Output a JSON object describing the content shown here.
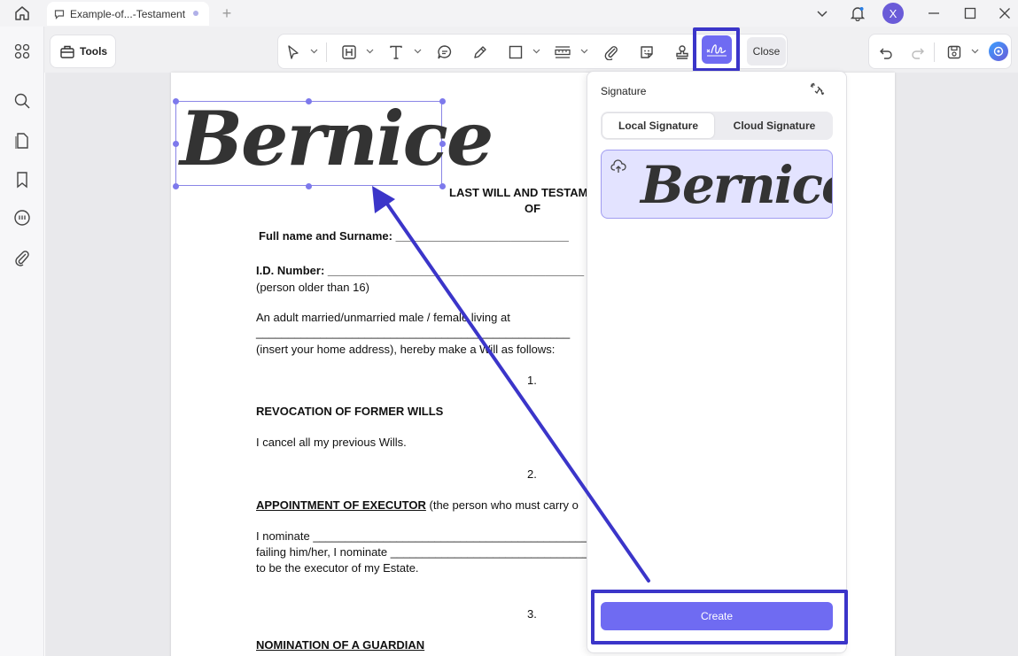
{
  "titlebar": {
    "tab_title": "Example-of...-Testament",
    "new_tab": "+",
    "avatar_letter": "X"
  },
  "toolbar": {
    "tools_label": "Tools",
    "close_label": "Close"
  },
  "document": {
    "signature_text": "Bernice",
    "heading_line1": "LAST WILL AND TESTAM",
    "heading_line2": "OF",
    "full_name": "Full name and Surname: ___________________________",
    "id_number": "I.D. Number: ________________________________________",
    "person_older": "(person older than 16)",
    "adult_line": "An adult married/unmarried male / female living at",
    "address_line": "_________________________________________________",
    "insert_address": "(insert your home address), hereby make a Will as follows:",
    "num1": "1.",
    "revocation_heading": "REVOCATION OF FORMER WILLS",
    "cancel_text": "I cancel all my previous Wills.",
    "num2": "2.",
    "executor_heading": "APPOINTMENT OF EXECUTOR",
    "executor_rest": " (the person who must carry o",
    "nominate1": "I nominate ___________________________________________",
    "nominate2": "failing   him/her, I nominate ________________________________",
    "executor_estate": "to be the executor of my Estate.",
    "num3": "3.",
    "guardian_heading": "NOMINATION  OF A GUARDIAN"
  },
  "signature_panel": {
    "title": "Signature",
    "tab_local": "Local Signature",
    "tab_cloud": "Cloud Signature",
    "saved_signature": "Bernice",
    "create_label": "Create"
  },
  "colors": {
    "accent": "#6f6bf2",
    "highlight_border": "#3b35c9",
    "annotation_arrow": "#3b35c9"
  }
}
